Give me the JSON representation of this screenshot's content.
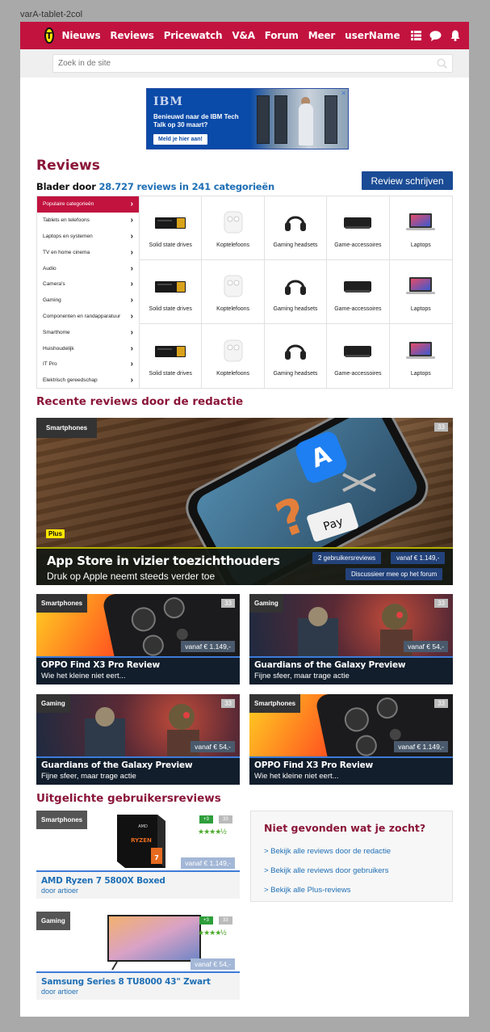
{
  "frame_label": "varA-tablet-2col",
  "header": {
    "nav": [
      "Nieuws",
      "Reviews",
      "Pricewatch",
      "V&A",
      "Forum",
      "Meer"
    ],
    "username": "userName",
    "logo_letter": "T"
  },
  "search": {
    "placeholder": "Zoek in de site"
  },
  "ad": {
    "brand": "IBM",
    "text": "Benieuwd naar de IBM Tech Talk op 30 maart?",
    "button": "Meld je hier aan!",
    "close": "✕"
  },
  "reviews": {
    "title": "Reviews",
    "subtitle_prefix": "Blader door ",
    "subtitle_highlight": "28.727 reviews in 241 categorieën",
    "write_button": "Review schrijven"
  },
  "categories": [
    "Populaire categorieën",
    "Tablets en telefoons",
    "Laptops en systemen",
    "TV en home cinema",
    "Audio",
    "Camera's",
    "Gaming",
    "Componenten en randapparatuur",
    "Smarthome",
    "Huishoudelijk",
    "IT Pro",
    "Elektrisch gereedschap"
  ],
  "grid_items": [
    "Solid state drives",
    "Koptelefoons",
    "Gaming headsets",
    "Game-accessoires",
    "Laptops",
    "Solid state drives",
    "Koptelefoons",
    "Gaming headsets",
    "Game-accessoires",
    "Laptops",
    "Solid state drives",
    "Koptelefoons",
    "Gaming headsets",
    "Game-accessoires",
    "Laptops"
  ],
  "recent": {
    "title": "Recente reviews door de redactie",
    "hero": {
      "tag": "Smartphones",
      "count": "33",
      "plus": "Plus",
      "title": "App Store in vizier toezichthouders",
      "subtitle": "Druk op Apple neemt steeds verder toe",
      "user_reviews": "2 gebruikersreviews",
      "price": "vanaf € 1.149,-",
      "discuss": "Discussieer mee op het forum"
    },
    "cards": [
      {
        "tag": "Smartphones",
        "count": "33",
        "price": "vanaf € 1.149,-",
        "title": "OPPO Find X3 Pro Review",
        "subtitle": "Wie het kleine niet eert..."
      },
      {
        "tag": "Gaming",
        "count": "33",
        "price": "vanaf € 54,-",
        "title": "Guardians of the Galaxy Preview",
        "subtitle": "Fijne sfeer, maar trage actie"
      },
      {
        "tag": "Gaming",
        "count": "33",
        "price": "vanaf € 54,-",
        "title": "Guardians of the Galaxy Preview",
        "subtitle": "Fijne sfeer, maar trage actie"
      },
      {
        "tag": "Smartphones",
        "count": "33",
        "price": "vanaf € 1.149,-",
        "title": "OPPO Find X3 Pro Review",
        "subtitle": "Wie het kleine niet eert..."
      }
    ]
  },
  "user_reviews": {
    "title": "Uitgelichte gebruikersreviews",
    "items": [
      {
        "tag": "Smartphones",
        "score": "+3",
        "count": "33",
        "stars": "★★★★½",
        "price": "vanaf € 1.149,-",
        "title": "AMD Ryzen 7 5800X Boxed",
        "author": "door artioer",
        "cpu_brand": "AMD",
        "cpu_name": "RYZEN",
        "cpu_num": "7"
      },
      {
        "tag": "Gaming",
        "score": "+3",
        "count": "33",
        "stars": "★★★★½",
        "price": "vanaf € 54,-",
        "title": "Samsung Series 8 TU8000 43\" Zwart",
        "author": "door artioer"
      }
    ]
  },
  "notfound": {
    "title": "Niet gevonden wat je zocht?",
    "links": [
      "> Bekijk alle reviews door de redactie",
      "> Bekijk alle reviews door gebruikers",
      "> Bekijk alle Plus-reviews"
    ]
  },
  "colors": {
    "brand": "#c2133f",
    "heading": "#8a1538",
    "link": "#1f6fb5",
    "button": "#1a4b95"
  }
}
